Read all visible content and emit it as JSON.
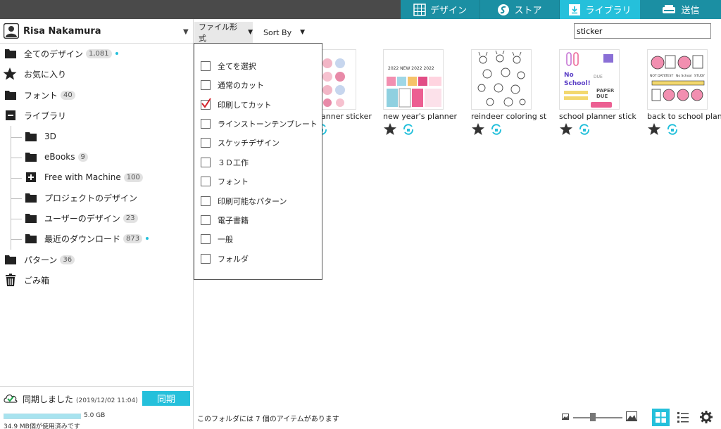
{
  "topnav": {
    "design": "デザイン",
    "store": "ストア",
    "library": "ライブラリ",
    "send": "送信"
  },
  "user": {
    "name": "Risa Nakamura"
  },
  "sidebar": {
    "all_designs": {
      "label": "全てのデザイン",
      "count": "1,081"
    },
    "favorites": {
      "label": "お気に入り"
    },
    "fonts": {
      "label": "フォント",
      "count": "40"
    },
    "library": {
      "label": "ライブラリ"
    },
    "library_children": [
      {
        "label": "3D",
        "count": ""
      },
      {
        "label": "eBooks",
        "count": "9"
      },
      {
        "label": "Free with Machine",
        "count": "100"
      },
      {
        "label": "プロジェクトのデザイン",
        "count": ""
      },
      {
        "label": "ユーザーのデザイン",
        "count": "23"
      },
      {
        "label": "最近のダウンロード",
        "count": "873"
      }
    ],
    "patterns": {
      "label": "パターン",
      "count": "36"
    },
    "trash": {
      "label": "ごみ箱"
    }
  },
  "sync": {
    "status": "同期しました",
    "date": "(2019/12/02 11:04)",
    "button": "同期",
    "capacity": "5.0 GB",
    "used": "34.9 MB個が使用済みです",
    "used_fraction": 0.007
  },
  "toolbar": {
    "filter_label": "ファイル形式",
    "sort_label": "Sort By",
    "search_value": "sticker"
  },
  "filter_menu": [
    {
      "label": "全てを選択",
      "checked": false
    },
    {
      "label": "通常のカット",
      "checked": false
    },
    {
      "label": "印刷してカット",
      "checked": true
    },
    {
      "label": "ラインストーンテンプレート",
      "checked": false
    },
    {
      "label": "スケッチデザイン",
      "checked": false
    },
    {
      "label": "３Ｄ工作",
      "checked": false
    },
    {
      "label": "フォント",
      "checked": false
    },
    {
      "label": "印刷可能なパターン",
      "checked": false
    },
    {
      "label": "電子書籍",
      "checked": false
    },
    {
      "label": "一般",
      "checked": false
    },
    {
      "label": "フォルダ",
      "checked": false
    }
  ],
  "grid": [
    {
      "title": "lanner sticker"
    },
    {
      "title": "new year's planner"
    },
    {
      "title": "reindeer coloring st"
    },
    {
      "title": "school planner stick"
    },
    {
      "title": "back to school plan"
    }
  ],
  "thumb_text": {
    "school_no": "No",
    "school_school": "School!",
    "school_due": "DUE",
    "school_paper": "PAPER",
    "school_due2": "DUE",
    "apples_labels": [
      "NOT DATE",
      "TEST",
      "No School",
      "STUDY"
    ]
  },
  "status": {
    "text": "このフォルダには 7 個のアイテムがあります"
  },
  "colors": {
    "accent": "#25c0db",
    "topbar": "#4a4a4a",
    "nav_dark": "#1b8fa3",
    "check": "#d3222a"
  }
}
